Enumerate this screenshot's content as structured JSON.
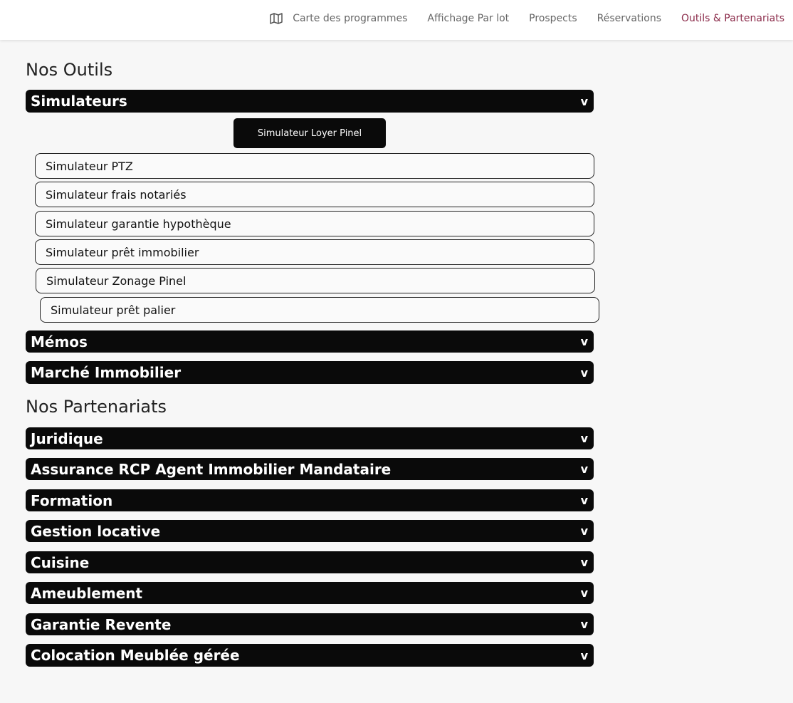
{
  "nav": {
    "items": [
      {
        "label": "Carte des programmes",
        "icon": "map-icon"
      },
      {
        "label": "Affichage Par lot"
      },
      {
        "label": "Prospects"
      },
      {
        "label": "Réservations"
      },
      {
        "label": "Outils & Partenariats",
        "active": true
      }
    ],
    "active_color": "#8b2b4a"
  },
  "outils": {
    "title": "Nos Outils",
    "sections": {
      "simulateurs": "Simulateurs",
      "memos": "Mémos",
      "marche": "Marché Immobilier"
    },
    "primary_button": "Simulateur Loyer Pinel",
    "simulators": [
      "Simulateur PTZ",
      "Simulateur frais notariés",
      "Simulateur garantie hypothèque",
      "Simulateur prêt immobilier",
      "Simulateur Zonage Pinel",
      "Simulateur prêt palier"
    ]
  },
  "partenariats": {
    "title": "Nos Partenariats",
    "sections": [
      "Juridique",
      "Assurance RCP Agent Immobilier Mandataire",
      "Formation",
      "Gestion locative",
      "Cuisine",
      "Ameublement",
      "Garantie Revente",
      "Colocation Meublée gérée"
    ]
  },
  "chevron": "v"
}
